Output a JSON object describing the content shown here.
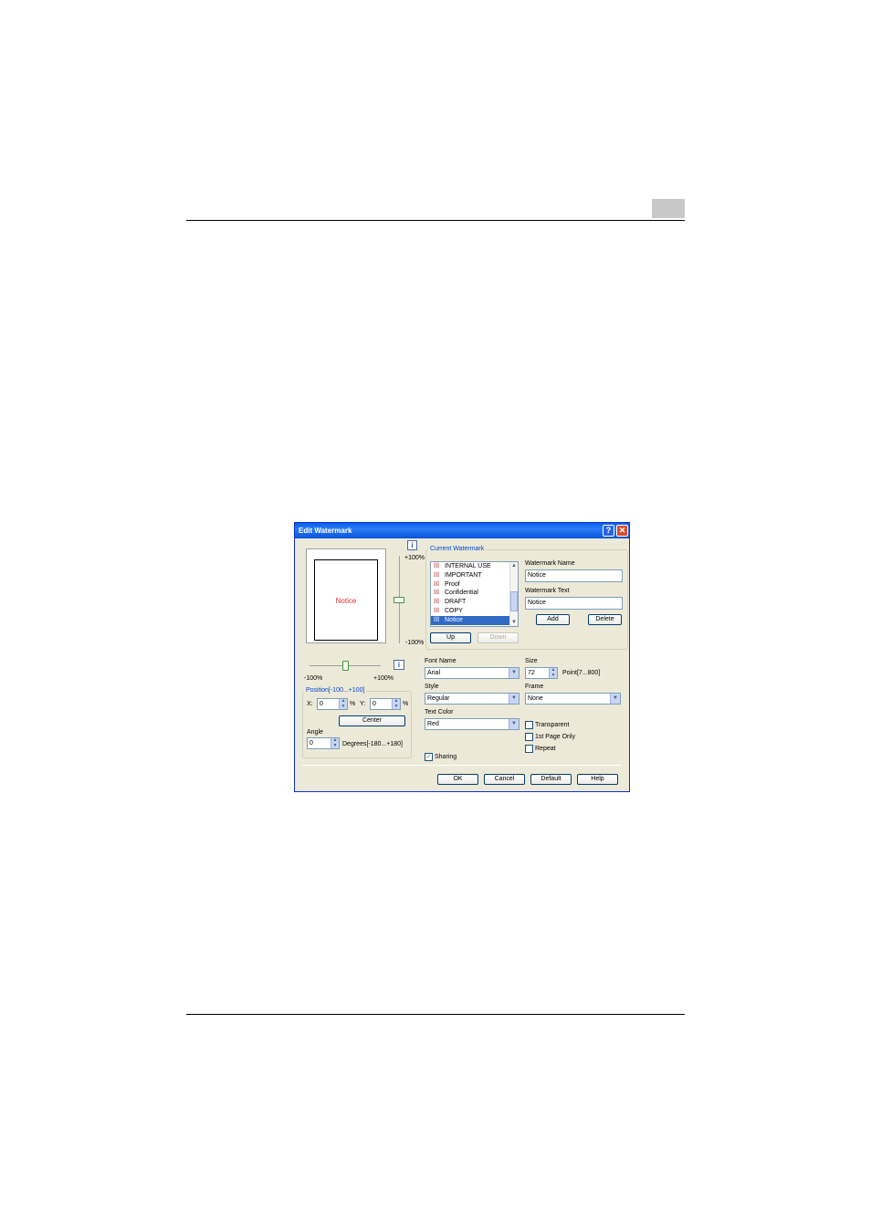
{
  "dialog": {
    "title": "Edit Watermark",
    "help_glyph": "?",
    "close_glyph": "✕"
  },
  "preview": {
    "text": "Notice",
    "text_color": "#e03030",
    "vertical_top_label": "+100%",
    "vertical_bottom_label": "-100%",
    "horizontal_left_label": "-100%",
    "horizontal_right_label": "+100%",
    "vertical_level": 0.5,
    "horizontal_level": 0.5
  },
  "position": {
    "group_label": "Position[-100...+100]",
    "x_label": "X:",
    "x_value": "0",
    "x_unit": "%",
    "y_label": "Y:",
    "y_value": "0",
    "y_unit": "%",
    "center_label": "Center",
    "angle_label": "Angle",
    "angle_value": "0",
    "angle_range": "Degrees[-180...+180]"
  },
  "current_watermark": {
    "group_label": "Current Watermark",
    "items": [
      "INTERNAL USE",
      "IMPORTANT",
      "Proof",
      "Confidential",
      "DRAFT",
      "COPY",
      "Notice"
    ],
    "selected": "Notice",
    "up_label": "Up",
    "down_label": "Down"
  },
  "watermark_name": {
    "label": "Watermark Name",
    "value": "Notice"
  },
  "watermark_text": {
    "label": "Watermark Text",
    "value": "Notice"
  },
  "actions": {
    "add_label": "Add",
    "delete_label": "Delete"
  },
  "font": {
    "font_name_label": "Font Name",
    "font_name_value": "Arial",
    "size_label": "Size",
    "size_value": "72",
    "size_range": "Point[7...800]",
    "style_label": "Style",
    "style_value": "Regular",
    "frame_label": "Frame",
    "frame_value": "None",
    "text_color_label": "Text Color",
    "text_color_value": "Red"
  },
  "options": {
    "transparent": {
      "label": "Transparent",
      "checked": false
    },
    "first_page_only": {
      "label": "1st Page Only",
      "checked": false
    },
    "repeat": {
      "label": "Repeat",
      "checked": false
    },
    "sharing": {
      "label": "Sharing",
      "checked": true
    }
  },
  "footer": {
    "ok_label": "OK",
    "cancel_label": "Cancel",
    "default_label": "Default",
    "help_label": "Help"
  },
  "icons": {
    "check": "✓",
    "dropdown": "▼",
    "spin_up": "▲",
    "spin_down": "▼",
    "info": "i",
    "watermark_item": "☒"
  },
  "colors": {
    "titlebar": "#0a5fe8",
    "dialog_bg": "#ece9d8",
    "selection": "#316ac5",
    "group_label": "#0046d5"
  }
}
